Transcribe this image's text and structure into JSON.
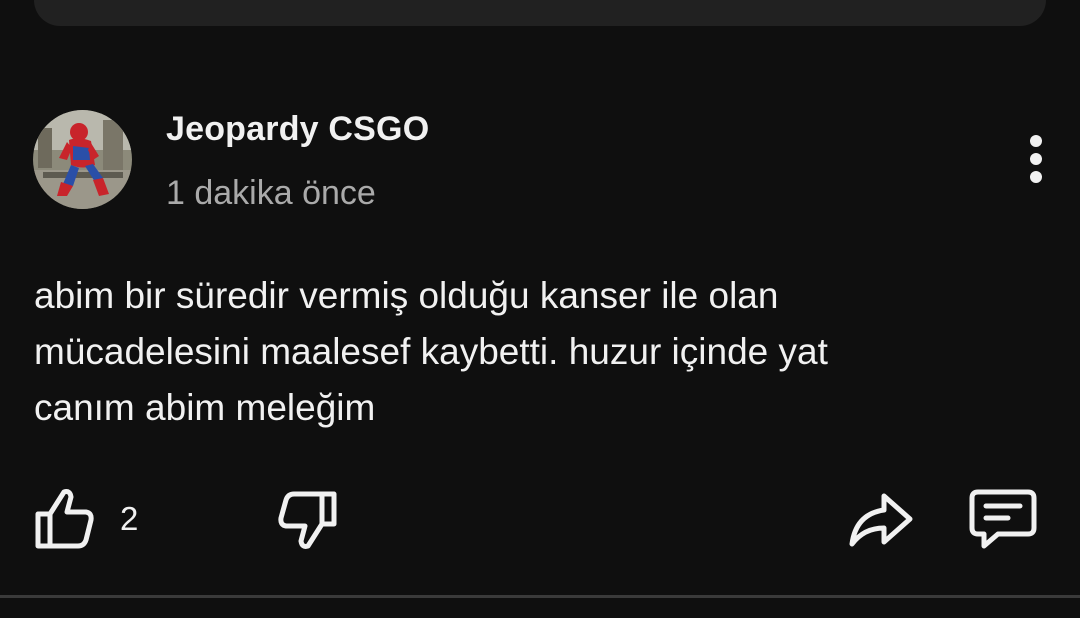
{
  "comment": {
    "author": "Jeopardy CSGO",
    "timestamp": "1 dakika önce",
    "text_lines": [
      "abim bir süredir vermiş olduğu kanser ile olan",
      "mücadelesini maalesef kaybetti. huzur içinde yat",
      "canım abim meleğim"
    ],
    "like_count": "2"
  },
  "icons": {
    "avatar": "spiderman-avatar",
    "more": "vertical-ellipsis-icon",
    "like": "thumbs-up-icon",
    "dislike": "thumbs-down-icon",
    "share": "share-arrow-icon",
    "reply": "comment-bubble-icon"
  },
  "colors": {
    "background": "#0f0f0f",
    "card": "#212121",
    "text_primary": "#f1f1f1",
    "text_secondary": "#aaaaaa",
    "divider": "#3a3a3a"
  }
}
